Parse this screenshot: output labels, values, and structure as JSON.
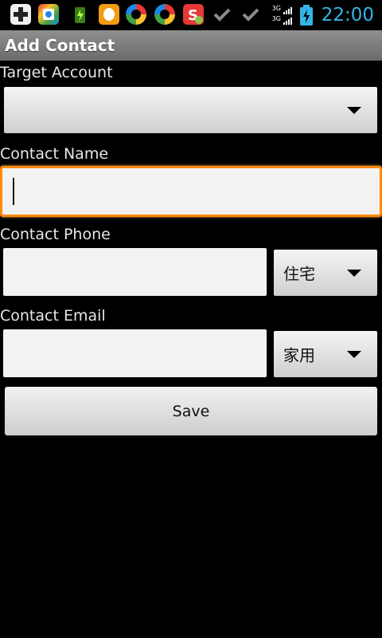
{
  "status_bar": {
    "time": "22:00",
    "network_label_top": "3G",
    "network_label_bottom": "3G",
    "notification_icons": [
      "add-icon",
      "app-store-icon",
      "battery-saver-icon",
      "qq-icon",
      "browser-icon",
      "browser-icon",
      "sogou-input-icon",
      "check-icon",
      "check-icon"
    ],
    "clock_color": "#33b5e5"
  },
  "title_bar": {
    "title": "Add Contact"
  },
  "form": {
    "target_account_label": "Target Account",
    "target_account_value": "",
    "contact_name_label": "Contact Name",
    "contact_name_value": "",
    "contact_phone_label": "Contact Phone",
    "contact_phone_value": "",
    "phone_type_value": "住宅",
    "contact_email_label": "Contact Email",
    "contact_email_value": "",
    "email_type_value": "家用",
    "save_label": "Save"
  },
  "colors": {
    "focus_border": "#ff8a00",
    "background": "#000000"
  }
}
